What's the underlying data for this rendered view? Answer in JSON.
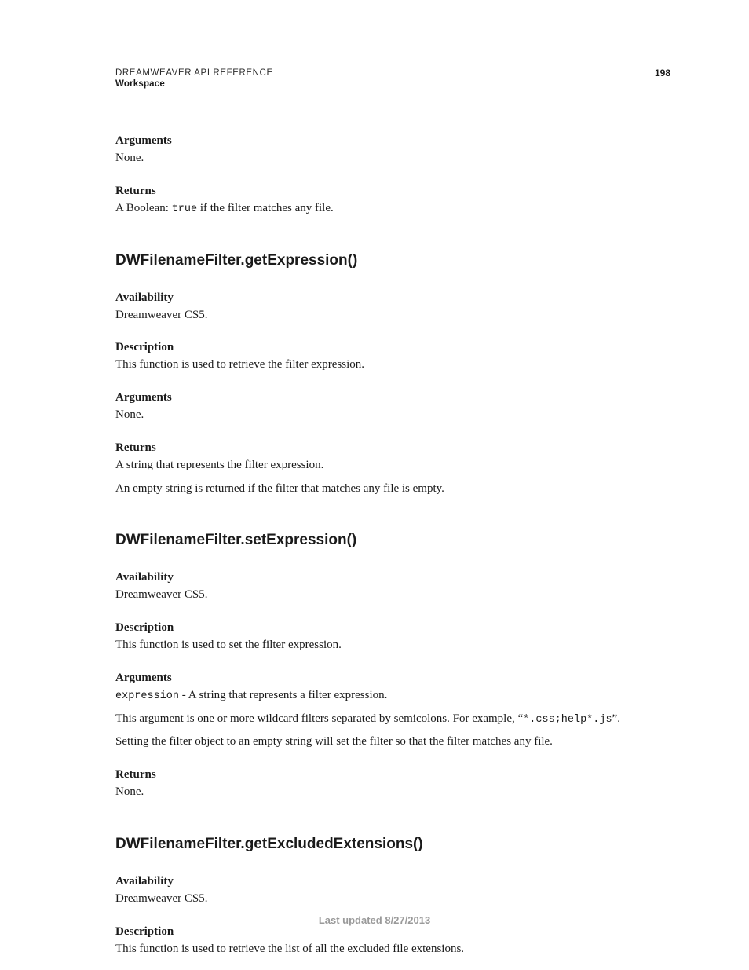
{
  "header": {
    "title": "DREAMWEAVER API REFERENCE",
    "subtitle": "Workspace",
    "page_number": "198"
  },
  "top_fragment": {
    "arguments_label": "Arguments",
    "arguments_body": "None.",
    "returns_label": "Returns",
    "returns_prefix": "A Boolean: ",
    "returns_code": "true",
    "returns_suffix": " if the filter matches any file."
  },
  "sections": {
    "getExpression": {
      "heading": "DWFilenameFilter.getExpression()",
      "availability_label": "Availability",
      "availability_body": "Dreamweaver CS5.",
      "description_label": "Description",
      "description_body": "This function is used to retrieve the filter expression.",
      "arguments_label": "Arguments",
      "arguments_body": "None.",
      "returns_label": "Returns",
      "returns_line1": "A string that represents the filter expression.",
      "returns_line2": "An empty string is returned if the filter that matches any file is empty."
    },
    "setExpression": {
      "heading": "DWFilenameFilter.setExpression()",
      "availability_label": "Availability",
      "availability_body": "Dreamweaver CS5.",
      "description_label": "Description",
      "description_body": "This function is used to set the filter expression.",
      "arguments_label": "Arguments",
      "arguments_code": "expression",
      "arguments_suffix": " - A string that represents a filter expression.",
      "arguments_line2_prefix": "This argument is one or more wildcard filters separated by semicolons. For example, “",
      "arguments_line2_code": "*.css;help*.js",
      "arguments_line2_suffix": "”.",
      "arguments_line3": "Setting the filter object to an empty string will set the filter so that the filter matches any file.",
      "returns_label": "Returns",
      "returns_body": "None."
    },
    "getExcludedExtensions": {
      "heading": "DWFilenameFilter.getExcludedExtensions()",
      "availability_label": "Availability",
      "availability_body": "Dreamweaver CS5.",
      "description_label": "Description",
      "description_body": "This function is used to retrieve the list of all the excluded file extensions."
    }
  },
  "footer": "Last updated 8/27/2013"
}
